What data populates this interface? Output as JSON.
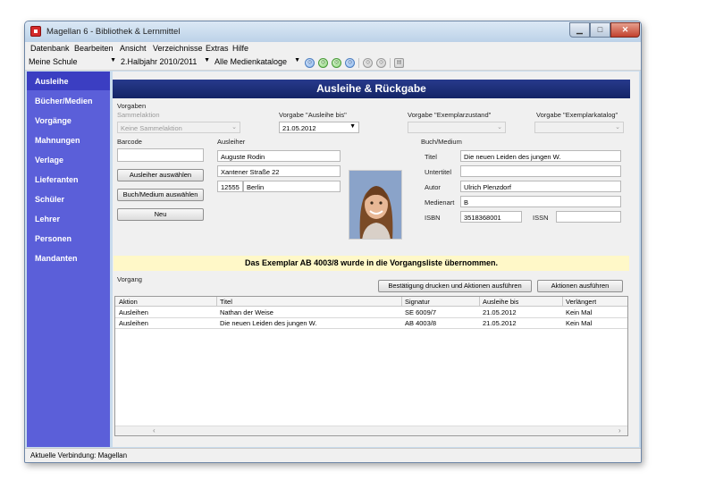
{
  "window": {
    "title": "Magellan 6 - Bibliothek & Lernmittel"
  },
  "menu": [
    "Datenbank",
    "Bearbeiten",
    "Ansicht",
    "Verzeichnisse",
    "Extras",
    "Hilfe"
  ],
  "toolbar": {
    "school": "Meine Schule",
    "period": "2.Halbjahr 2010/2011",
    "catalog": "Alle Medienkataloge"
  },
  "sidebar": {
    "items": [
      "Ausleihe",
      "Bücher/Medien",
      "Vorgänge",
      "Mahnungen",
      "Verlage",
      "Lieferanten",
      "Schüler",
      "Lehrer",
      "Personen",
      "Mandanten"
    ],
    "active_index": 0
  },
  "header": {
    "title": "Ausleihe & Rückgabe"
  },
  "vorgaben": {
    "label": "Vorgaben",
    "sammelaktion_label": "Sammelaktion",
    "sammelaktion_value": "Keine Sammelaktion",
    "ausleihe_bis_label": "Vorgabe \"Ausleihe bis\"",
    "ausleihe_bis_value": "21.05.2012",
    "exemplarzustand_label": "Vorgabe \"Exemplarzustand\"",
    "exemplarkatalog_label": "Vorgabe \"Exemplarkatalog\""
  },
  "barcode": {
    "label": "Barcode",
    "value": "",
    "btn_ausleiher": "Ausleiher auswählen",
    "btn_medium": "Buch/Medium auswählen",
    "btn_neu": "Neu"
  },
  "ausleiher": {
    "label": "Ausleiher",
    "name": "Auguste Rodin",
    "street": "Xantener Straße 22",
    "zip": "12555",
    "city": "Berlin"
  },
  "medium": {
    "label": "Buch/Medium",
    "titel_label": "Titel",
    "titel": "Die neuen Leiden des jungen W.",
    "untertitel_label": "Untertitel",
    "untertitel": "",
    "autor_label": "Autor",
    "autor": "Ulrich Plenzdorf",
    "medienart_label": "Medienart",
    "medienart": "B",
    "isbn_label": "ISBN",
    "isbn": "3518368001",
    "issn_label": "ISSN",
    "issn": ""
  },
  "notice": "Das Exemplar AB 4003/8 wurde in die Vorgangsliste übernommen.",
  "vorgang": {
    "label": "Vorgang",
    "btn_print": "Bestätigung drucken und Aktionen ausführen",
    "btn_execute": "Aktionen ausführen",
    "columns": [
      "Aktion",
      "Titel",
      "Signatur",
      "Ausleihe bis",
      "Verlängert"
    ],
    "rows": [
      [
        "Ausleihen",
        "Nathan der Weise",
        "SE 6009/7",
        "21.05.2012",
        "Kein Mal"
      ],
      [
        "Ausleihen",
        "Die neuen Leiden des jungen W.",
        "AB 4003/8",
        "21.05.2012",
        "Kein Mal"
      ]
    ]
  },
  "status": {
    "connection": "Aktuelle Verbindung: Magellan"
  },
  "colors": {
    "sidebar": "#5b5fd9",
    "sidebar_active": "#3b3ec2",
    "header": "#1c2d7a",
    "notice": "#fff8c8"
  }
}
